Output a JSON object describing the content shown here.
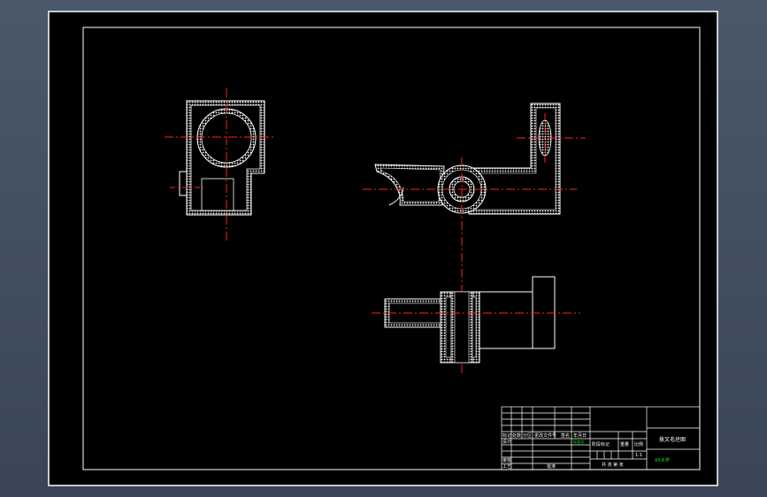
{
  "colors": {
    "app_background": "#46546a",
    "canvas": "#000000",
    "outline": "#ffffff",
    "centerline": "#ff2020",
    "title_block_text": "#ffffff",
    "green_text": "#00ff00"
  },
  "title_block": {
    "row_labels": [
      "标记",
      "处数",
      "分区",
      "更改文件号",
      "签名",
      "年月日"
    ],
    "designer_label": "设计",
    "standardization_label": "标准化",
    "stage_mark_label": "阶段标记",
    "weight_label": "重量",
    "scale_label": "比例",
    "scale_value": "1:1",
    "review_label": "审核",
    "process_label": "工艺",
    "approve_label": "批准",
    "sheet_text": "共  张  第  张",
    "drawing_name": "拨叉毛坯图",
    "company": "XX大学"
  }
}
